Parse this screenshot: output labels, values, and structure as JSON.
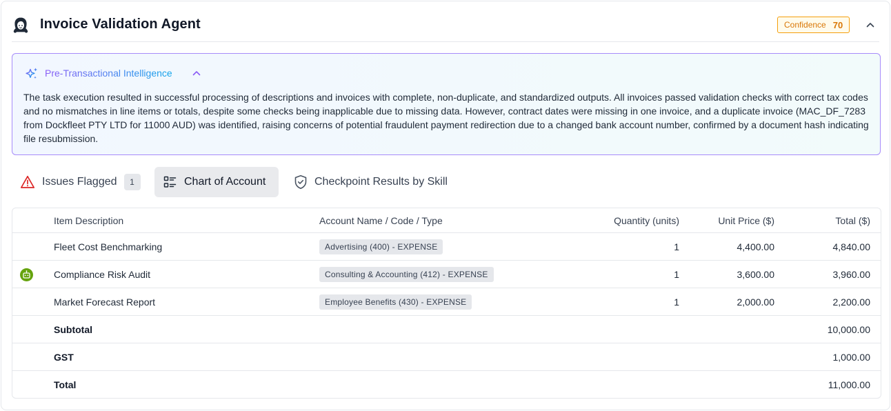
{
  "header": {
    "title": "Invoice Validation Agent",
    "confidence_label": "Confidence",
    "confidence_value": "70"
  },
  "intelligence": {
    "title": "Pre-Transactional Intelligence",
    "summary": "The task execution resulted in successful processing of descriptions and invoices with complete, non-duplicate, and standardized outputs. All invoices passed validation checks with correct tax codes and no mismatches in line items or totals, despite some checks being inapplicable due to missing data. However, contract dates were missing in one invoice, and a duplicate invoice (MAC_DF_7283 from Dockfleet PTY LTD for 11000 AUD) was identified, raising concerns of potential fraudulent payment redirection due to a changed bank account number, confirmed by a document hash indicating file resubmission."
  },
  "tabs": {
    "issues": {
      "label": "Issues Flagged",
      "count": "1"
    },
    "chart": {
      "label": "Chart of Account"
    },
    "checkpoint": {
      "label": "Checkpoint Results by Skill"
    }
  },
  "table": {
    "columns": {
      "description": "Item Description",
      "account": "Account Name / Code / Type",
      "quantity": "Quantity (units)",
      "unit_price": "Unit Price ($)",
      "total": "Total ($)"
    },
    "rows": [
      {
        "description": "Fleet Cost Benchmarking",
        "account": "Advertising (400) - EXPENSE",
        "quantity": "1",
        "unit_price": "4,400.00",
        "total": "4,840.00"
      },
      {
        "description": "Compliance Risk Audit",
        "account": "Consulting & Accounting (412) - EXPENSE",
        "quantity": "1",
        "unit_price": "3,600.00",
        "total": "3,960.00",
        "icon": "robot-icon"
      },
      {
        "description": "Market Forecast Report",
        "account": "Employee Benefits (430) - EXPENSE",
        "quantity": "1",
        "unit_price": "2,000.00",
        "total": "2,200.00"
      }
    ],
    "summary": {
      "subtotal_label": "Subtotal",
      "subtotal_value": "10,000.00",
      "gst_label": "GST",
      "gst_value": "1,000.00",
      "total_label": "Total",
      "total_value": "11,000.00"
    }
  },
  "colors": {
    "accent_orange": "#f59e0b",
    "intel_border": "#a78bfa",
    "warning_red": "#dc2626",
    "robot_green": "#65a30d"
  }
}
